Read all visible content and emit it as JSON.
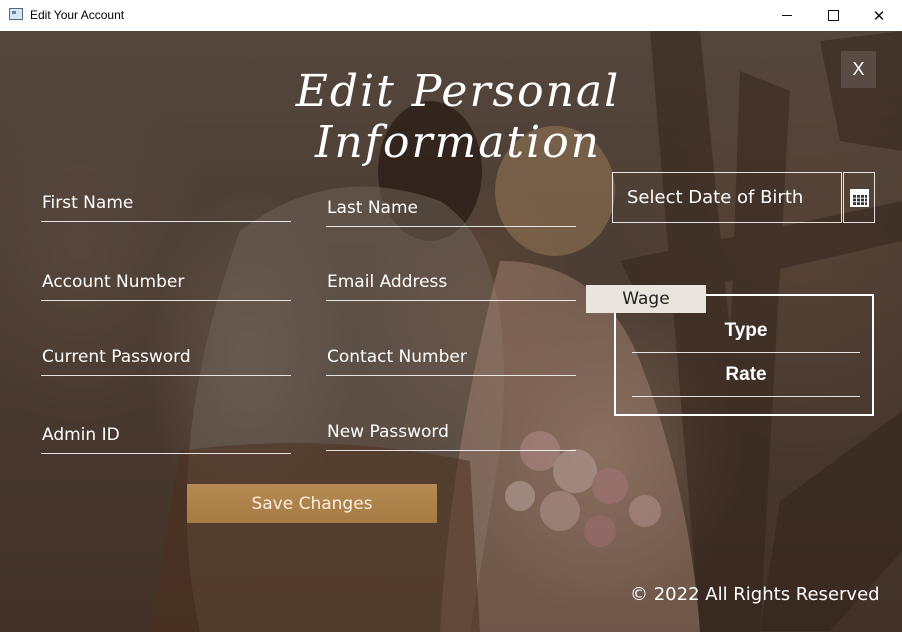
{
  "window": {
    "title": "Edit Your Account",
    "controls": {
      "minimize": "minimize",
      "maximize": "maximize",
      "close": "✕"
    }
  },
  "form": {
    "heading": "Edit Personal Information",
    "close_label": "X",
    "fields": {
      "first_name": "First Name",
      "last_name": "Last Name",
      "account_number": "Account Number",
      "email_address": "Email Address",
      "current_password": "Current Password",
      "contact_number": "Contact Number",
      "admin_id": "Admin ID",
      "new_password": "New Password"
    },
    "date_of_birth": {
      "placeholder": "Select Date of Birth",
      "icon": "calendar-icon"
    },
    "wage": {
      "title": "Wage",
      "type_label": "Type",
      "rate_label": "Rate"
    },
    "save_button": "Save Changes",
    "footer": "© 2022 All Rights Reserved"
  },
  "colors": {
    "accent": "#b08449",
    "text": "#ffffff"
  }
}
